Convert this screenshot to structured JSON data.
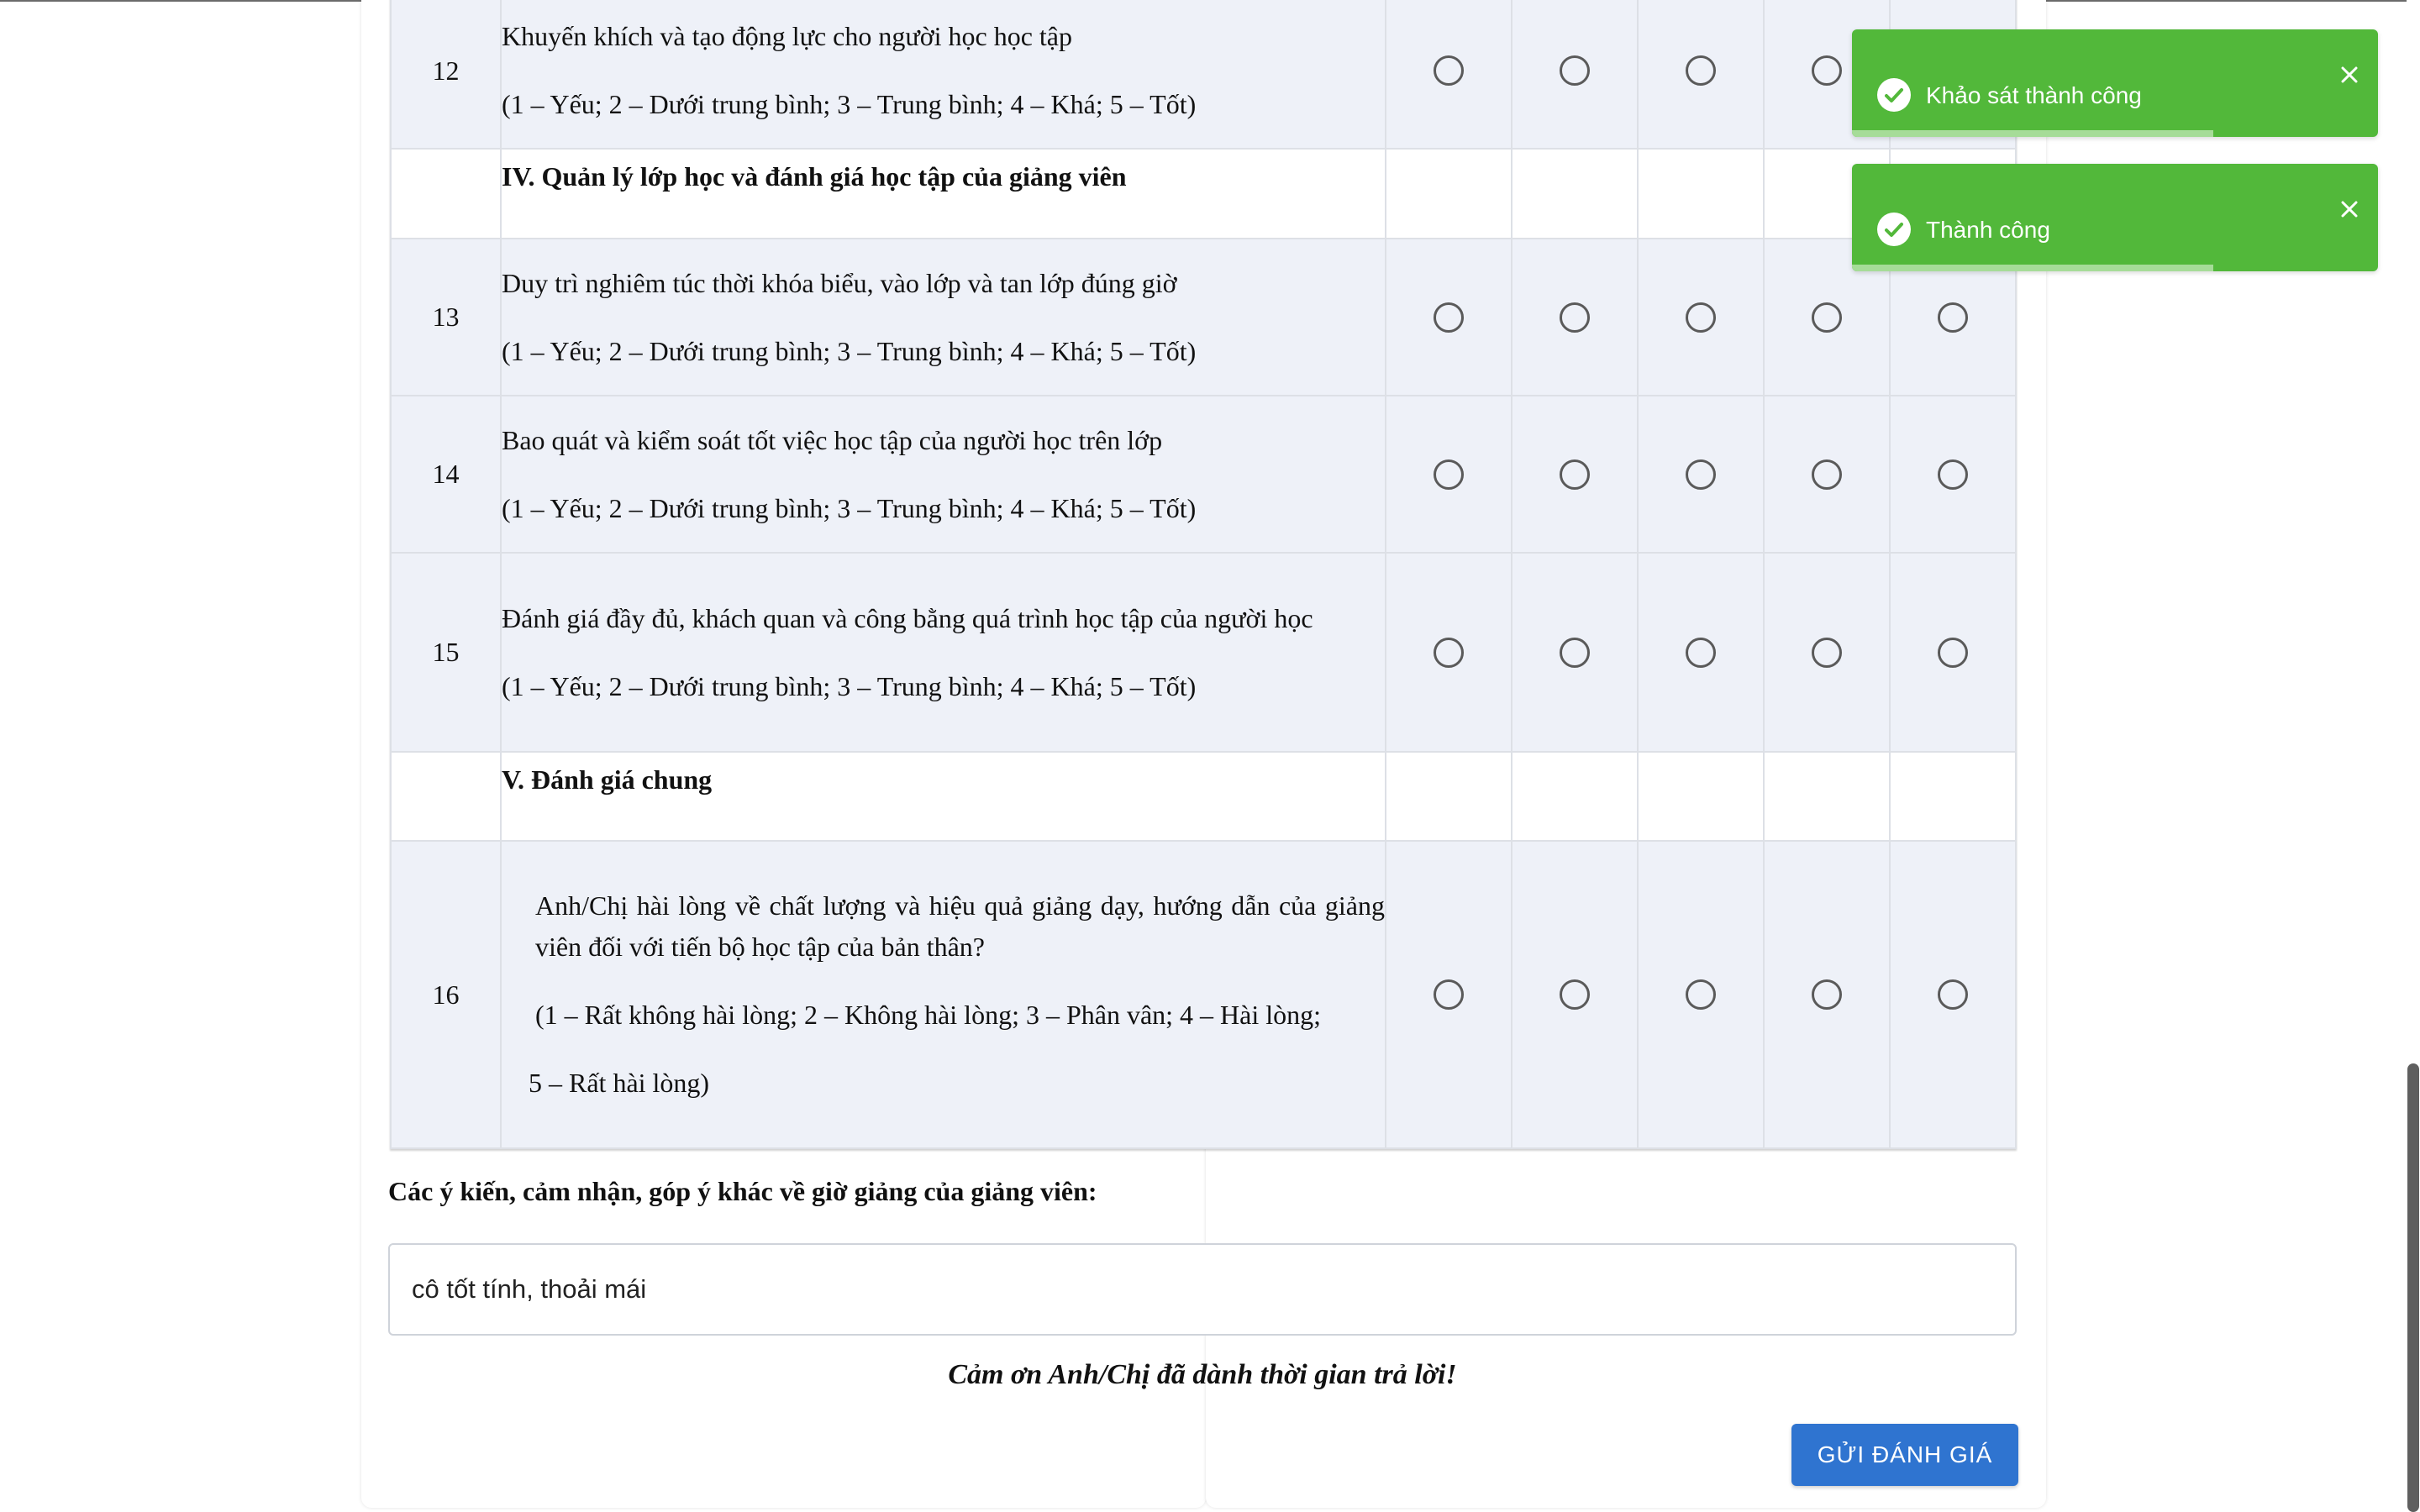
{
  "survey": {
    "rows": [
      {
        "type": "question",
        "no": "12",
        "text": "Khuyến khích và tạo động lực cho người học học tập",
        "scale": "(1 – Yếu; 2 – Dưới trung bình; 3 – Trung bình; 4 – Khá; 5 – Tốt)"
      },
      {
        "type": "section",
        "title": "IV. Quản lý lớp học và đánh giá học tập của giảng viên"
      },
      {
        "type": "question",
        "no": "13",
        "text": "Duy trì nghiêm túc thời khóa biểu, vào lớp và tan lớp đúng giờ",
        "scale": "(1 – Yếu; 2 – Dưới trung bình; 3 – Trung bình; 4 – Khá; 5 – Tốt)"
      },
      {
        "type": "question",
        "no": "14",
        "text": "Bao quát và kiểm soát tốt việc học tập của người học trên lớp",
        "scale": "(1 – Yếu; 2 – Dưới trung bình; 3 – Trung bình; 4 – Khá; 5 – Tốt)"
      },
      {
        "type": "question",
        "no": "15",
        "text": "Đánh giá đầy đủ, khách quan và công bằng quá trình học tập của người học",
        "scale": "(1 – Yếu; 2 – Dưới trung bình; 3 – Trung bình; 4 – Khá; 5 – Tốt)"
      },
      {
        "type": "section",
        "title": "V. Đánh giá chung"
      },
      {
        "type": "question",
        "no": "16",
        "text": "Anh/Chị hài lòng về chất lượng và hiệu quả giảng dạy, hướng dẫn của giảng viên đối với tiến bộ học tập của bản thân?",
        "scale": "(1 – Rất không hài lòng; 2 – Không hài lòng; 3 – Phân vân; 4 – Hài lòng;",
        "scale2": "5 – Rất hài lòng)"
      }
    ]
  },
  "comments": {
    "label": "Các ý kiến, cảm nhận, góp ý khác về giờ giảng của giảng viên:",
    "value": "cô tốt tính, thoải mái"
  },
  "thanks": "Cảm ơn Anh/Chị đã dành thời gian trả lời!",
  "submit_label": "GỬI ĐÁNH GIÁ",
  "toasts": [
    {
      "message": "Khảo sát thành công"
    },
    {
      "message": "Thành công"
    }
  ],
  "colors": {
    "toast_bg": "#52b83a",
    "submit_bg": "#2f74d0",
    "question_row_bg": "#eef1f8"
  },
  "icons": {
    "toast_status": "check-circle-icon",
    "toast_close": "close-icon"
  }
}
